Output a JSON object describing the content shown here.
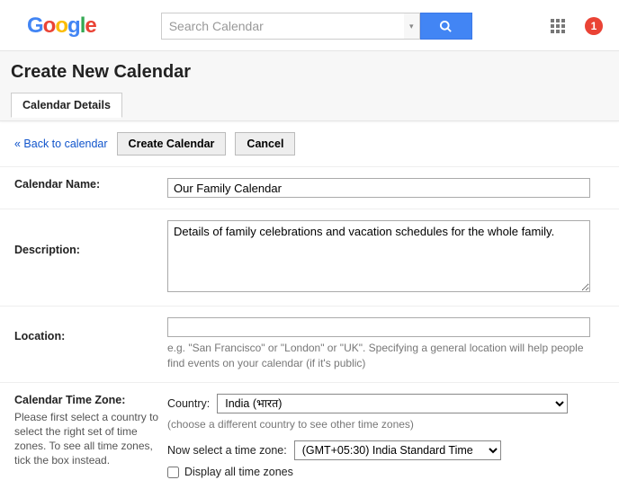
{
  "header": {
    "logo": {
      "c1": "G",
      "c2": "o",
      "c3": "o",
      "c4": "g",
      "c5": "l",
      "c6": "e"
    },
    "search_placeholder": "Search Calendar",
    "notif_count": "1"
  },
  "page": {
    "title": "Create New Calendar",
    "tab": "Calendar Details"
  },
  "actions": {
    "back": "« Back to calendar",
    "create": "Create Calendar",
    "cancel": "Cancel"
  },
  "fields": {
    "name": {
      "label": "Calendar Name:",
      "value": "Our Family Calendar"
    },
    "description": {
      "label": "Description:",
      "value": "Details of family celebrations and vacation schedules for the whole family."
    },
    "location": {
      "label": "Location:",
      "value": "",
      "hint": "e.g. \"San Francisco\" or \"London\" or \"UK\". Specifying a general location will help people find events on your calendar (if it's public)"
    },
    "timezone": {
      "label": "Calendar Time Zone:",
      "help": "Please first select a country to select the right set of time zones. To see all time zones, tick the box instead.",
      "country_label": "Country:",
      "country_value": "India (भारत)",
      "country_hint": "(choose a different country to see other time zones)",
      "tz_label": "Now select a time zone:",
      "tz_value": "(GMT+05:30) India Standard Time",
      "display_all": "Display all time zones"
    }
  }
}
